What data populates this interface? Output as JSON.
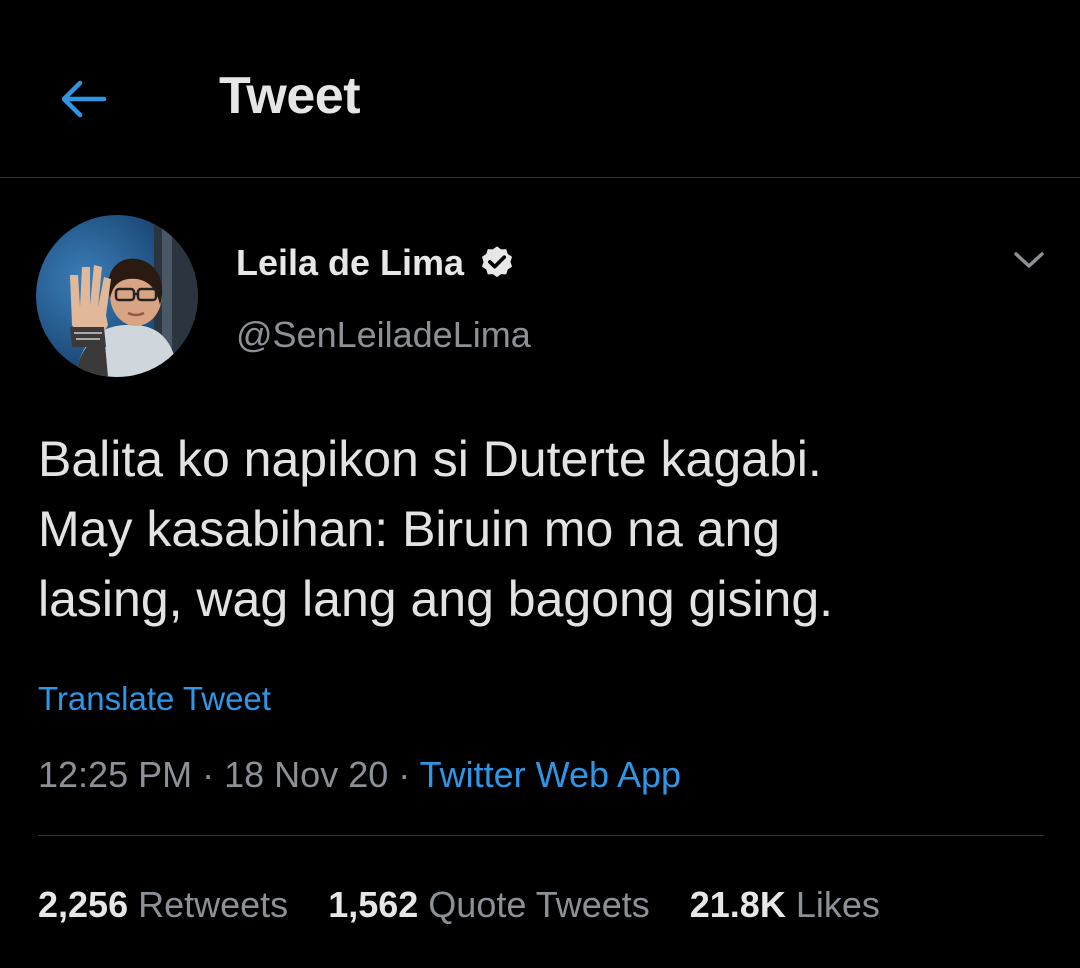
{
  "header": {
    "back_icon": "arrow-left-icon",
    "title": "Tweet"
  },
  "tweet": {
    "author": {
      "name": "Leila de Lima",
      "verified_icon": "verified-badge-icon",
      "handle": "@SenLeiladeLima"
    },
    "menu_icon": "chevron-down-icon",
    "text_lines": [
      "Balita ko napikon si Duterte kagabi.",
      "May kasabihan: Biruin mo na ang",
      "lasing, wag lang ang bagong gising."
    ],
    "translate_label": "Translate Tweet",
    "time": "12:25 PM",
    "separator": "·",
    "date": "18 Nov 20",
    "source": "Twitter Web App",
    "stats": {
      "retweets_count": "2,256",
      "retweets_label": "Retweets",
      "quotes_count": "1,562",
      "quotes_label": "Quote Tweets",
      "likes_count": "21.8K",
      "likes_label": "Likes"
    }
  },
  "colors": {
    "background": "#000000",
    "accent": "#2f96e6",
    "text_primary": "#e7e7e7",
    "text_secondary": "#8b9197",
    "divider": "#2f3336"
  }
}
